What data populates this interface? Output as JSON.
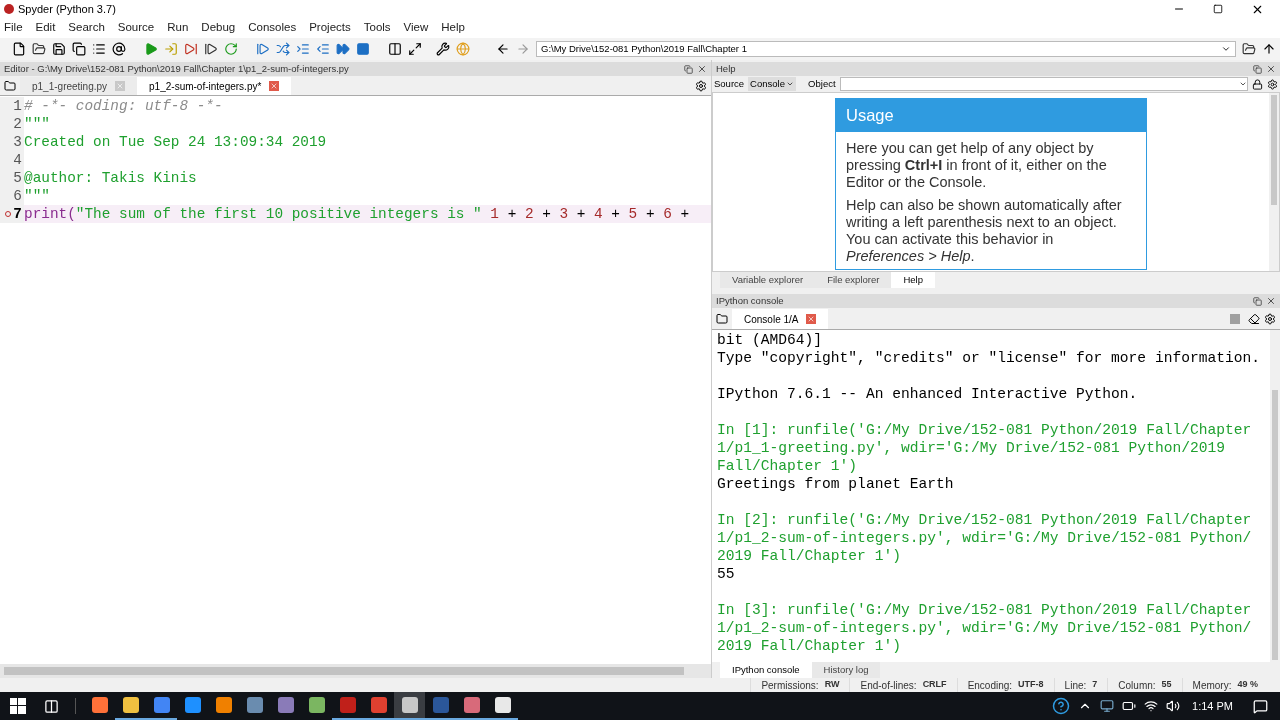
{
  "window": {
    "title": "Spyder (Python 3.7)"
  },
  "menu": [
    "File",
    "Edit",
    "Search",
    "Source",
    "Run",
    "Debug",
    "Consoles",
    "Projects",
    "Tools",
    "View",
    "Help"
  ],
  "path_field": {
    "value": "G:\\My Drive\\152-081 Python\\2019 Fall\\Chapter 1"
  },
  "editor": {
    "title": "Editor - G:\\My Drive\\152-081 Python\\2019 Fall\\Chapter 1\\p1_2-sum-of-integers.py",
    "tabs": [
      {
        "label": "p1_1-greeting.py",
        "selected": false
      },
      {
        "label": "p1_2-sum-of-integers.py*",
        "selected": true
      }
    ],
    "lines": [
      {
        "number": "1",
        "breakpoint": false,
        "current": false,
        "tokens": [
          {
            "kind": "comment",
            "text": "# -*- coding: utf-8 -*-"
          }
        ]
      },
      {
        "number": "2",
        "breakpoint": false,
        "current": false,
        "tokens": [
          {
            "kind": "string",
            "text": "\"\"\""
          }
        ]
      },
      {
        "number": "3",
        "breakpoint": false,
        "current": false,
        "tokens": [
          {
            "kind": "string",
            "text": "Created on Tue Sep 24 13:09:34 2019"
          }
        ]
      },
      {
        "number": "4",
        "breakpoint": false,
        "current": false
      },
      {
        "number": "5",
        "breakpoint": false,
        "current": false,
        "tokens": [
          {
            "kind": "string",
            "text": "@author: Takis Kinis"
          }
        ]
      },
      {
        "number": "6",
        "breakpoint": false,
        "current": false,
        "tokens": [
          {
            "kind": "string",
            "text": "\"\"\""
          }
        ]
      },
      {
        "number": "7",
        "breakpoint": true,
        "current": true,
        "tokens": [
          {
            "kind": "builtin",
            "text": "print("
          },
          {
            "kind": "string",
            "text": "\"The sum of the first 10 positive integers is \" "
          },
          {
            "kind": "number",
            "text": "1"
          },
          {
            "kind": "plain",
            "text": " + "
          },
          {
            "kind": "number",
            "text": "2"
          },
          {
            "kind": "plain",
            "text": " + "
          },
          {
            "kind": "number",
            "text": "3"
          },
          {
            "kind": "plain",
            "text": " + "
          },
          {
            "kind": "number",
            "text": "4"
          },
          {
            "kind": "plain",
            "text": " + "
          },
          {
            "kind": "number",
            "text": "5"
          },
          {
            "kind": "plain",
            "text": " + "
          },
          {
            "kind": "number",
            "text": "6"
          },
          {
            "kind": "plain",
            "text": " +"
          }
        ]
      }
    ]
  },
  "help": {
    "title": "Help",
    "source_label": "Source",
    "source_value": "Console",
    "object_label": "Object",
    "usage_title": "Usage",
    "paragraphs": [
      "Here you can get help of any object by pressing **Ctrl+I** in front of it, either on the Editor or the Console.",
      "Help can also be shown automatically after writing a left parenthesis next to an object. You can activate this behavior in *Preferences > Help*."
    ],
    "tabs": [
      {
        "label": "Variable explorer",
        "selected": false
      },
      {
        "label": "File explorer",
        "selected": false
      },
      {
        "label": "Help",
        "selected": true
      }
    ]
  },
  "console": {
    "title": "IPython console",
    "tab": "Console 1/A",
    "lines": [
      {
        "kind": "output",
        "text": "bit (AMD64)]"
      },
      {
        "kind": "output",
        "text": "Type \"copyright\", \"credits\" or \"license\" for more information."
      },
      {
        "kind": "blank"
      },
      {
        "kind": "output",
        "text": "IPython 7.6.1 -- An enhanced Interactive Python."
      },
      {
        "kind": "blank"
      },
      {
        "kind": "input",
        "text": "In [1]: runfile('G:/My Drive/152-081 Python/2019 Fall/Chapter"
      },
      {
        "kind": "input",
        "text": "1/p1_1-greeting.py', wdir='G:/My Drive/152-081 Python/2019"
      },
      {
        "kind": "input",
        "text": "Fall/Chapter 1')"
      },
      {
        "kind": "output",
        "text": "Greetings from planet Earth"
      },
      {
        "kind": "blank"
      },
      {
        "kind": "input",
        "text": "In [2]: runfile('G:/My Drive/152-081 Python/2019 Fall/Chapter"
      },
      {
        "kind": "input",
        "text": "1/p1_2-sum-of-integers.py', wdir='G:/My Drive/152-081 Python/"
      },
      {
        "kind": "input",
        "text": "2019 Fall/Chapter 1')"
      },
      {
        "kind": "output",
        "text": "55"
      },
      {
        "kind": "blank"
      },
      {
        "kind": "input",
        "text": "In [3]: runfile('G:/My Drive/152-081 Python/2019 Fall/Chapter"
      },
      {
        "kind": "input",
        "text": "1/p1_2-sum-of-integers.py', wdir='G:/My Drive/152-081 Python/"
      },
      {
        "kind": "input",
        "text": "2019 Fall/Chapter 1')"
      }
    ],
    "tabs": [
      {
        "label": "IPython console",
        "selected": true
      },
      {
        "label": "History log",
        "selected": false
      }
    ]
  },
  "status_bar": [
    {
      "label": "Permissions:",
      "value": "RW"
    },
    {
      "label": "End-of-lines:",
      "value": "CRLF"
    },
    {
      "label": "Encoding:",
      "value": "UTF-8"
    },
    {
      "label": "Line:",
      "value": "7"
    },
    {
      "label": "Column:",
      "value": "55"
    },
    {
      "label": "Memory:",
      "value": "49 %"
    }
  ],
  "taskbar": {
    "apps": [
      {
        "open": false,
        "selected": false
      },
      {
        "open": true,
        "selected": false
      },
      {
        "open": true,
        "selected": false
      },
      {
        "open": false,
        "selected": false
      },
      {
        "open": false,
        "selected": false
      },
      {
        "open": false,
        "selected": false
      },
      {
        "open": false,
        "selected": false
      },
      {
        "open": false,
        "selected": false
      },
      {
        "open": true,
        "selected": false
      },
      {
        "open": true,
        "selected": false
      },
      {
        "open": true,
        "selected": true
      },
      {
        "open": true,
        "selected": false
      },
      {
        "open": true,
        "selected": false
      },
      {
        "open": true,
        "selected": false
      }
    ],
    "clock": "1:14 PM"
  }
}
